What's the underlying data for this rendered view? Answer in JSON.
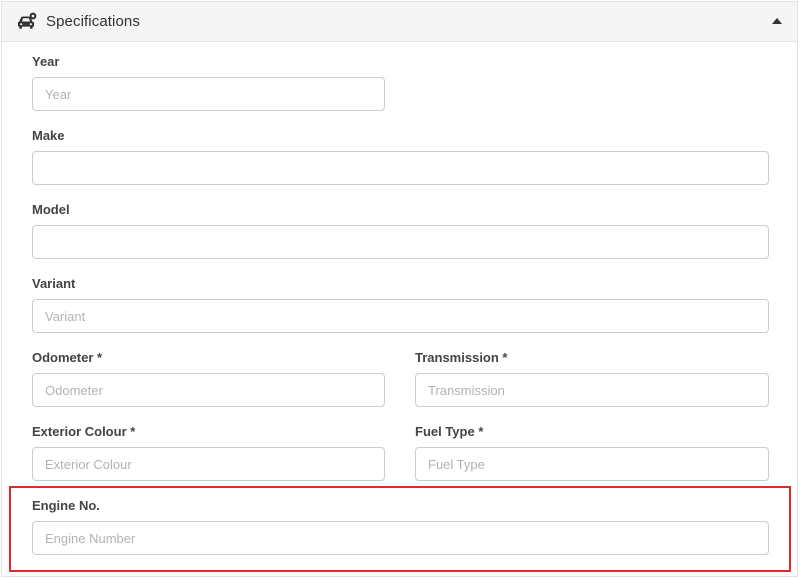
{
  "panel": {
    "title": "Specifications",
    "header_icon": "car-settings-icon",
    "collapse_icon": "caret-up-icon"
  },
  "fields": {
    "year": {
      "label": "Year",
      "placeholder": "Year",
      "value": ""
    },
    "make": {
      "label": "Make",
      "placeholder": "",
      "value": ""
    },
    "model": {
      "label": "Model",
      "placeholder": "",
      "value": ""
    },
    "variant": {
      "label": "Variant",
      "placeholder": "Variant",
      "value": ""
    },
    "odometer": {
      "label": "Odometer *",
      "placeholder": "Odometer",
      "value": ""
    },
    "transmission": {
      "label": "Transmission *",
      "placeholder": "Transmission",
      "value": ""
    },
    "exterior_colour": {
      "label": "Exterior Colour *",
      "placeholder": "Exterior Colour",
      "value": ""
    },
    "fuel_type": {
      "label": "Fuel Type *",
      "placeholder": "Fuel Type",
      "value": ""
    },
    "engine_no": {
      "label": "Engine No.",
      "placeholder": "Engine Number",
      "value": ""
    }
  },
  "colors": {
    "highlight": "#e02b27",
    "header_bg": "#f5f5f5",
    "border": "#cccccc"
  }
}
